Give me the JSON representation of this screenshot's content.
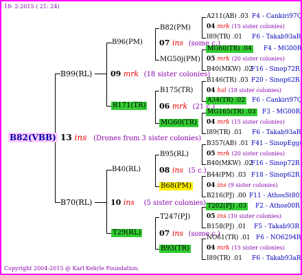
{
  "header": {
    "date": "18- 2-2015 ( 21: 24)"
  },
  "footer": {
    "copyright": "Copyright 2004-2015 @ Karl Kehrle Foundation."
  },
  "queen": {
    "name": "B82(VBB)",
    "year": "13",
    "mark": "ins",
    "note": "(Drones from 3 sister colonies)"
  },
  "sire": {
    "name": "B99(RL)",
    "year": "09",
    "mark": "mrk",
    "note": "(18 sister colonies)"
  },
  "dam": {
    "name": "B70(RL)",
    "year": "10",
    "mark": "ins",
    "note": "(5 sister colonies)"
  },
  "sire_sire": {
    "name": "B96(PM)",
    "year": "07",
    "mark": "ins",
    "note": "(some c.)"
  },
  "sire_dam": {
    "name": "B171(TR)",
    "year": "06",
    "mark": "mrk",
    "note": "(21 c.)"
  },
  "dam_sire": {
    "name": "B40(RL)",
    "year": "08",
    "mark": "ins",
    "note": "(5 c.)"
  },
  "dam_dam": {
    "name": "T29(RL)",
    "year": "07",
    "mark": "ins",
    "note": "(some c.)"
  },
  "gen3": [
    {
      "name": "B82(PM)"
    },
    {
      "name": "MG50j(PM)"
    },
    {
      "name": "B175(TR)"
    },
    {
      "name": "MG60(TR)"
    },
    {
      "name": "B95(RL)"
    },
    {
      "name": "B68(PM)"
    },
    {
      "name": "T247(PJ)"
    },
    {
      "name": "B93(TR)"
    }
  ],
  "gen4": [
    {
      "left": "A211(AB) .03",
      "right": "F4 - Cankiri97Q"
    },
    {
      "year": "04",
      "mark": "mrk",
      "note": "(15 sister colonies)"
    },
    {
      "left": "I89(TR) .01",
      "right": "F6 - Takab93aR"
    },
    {
      "left": "MG60(TR) .04",
      "right": "F4 - MG00R"
    },
    {
      "year": "05",
      "mark": "mrk",
      "note": "(20 sister colonies)"
    },
    {
      "left": "B40(MKW) .02",
      "right": "F16 - Sinop72R"
    },
    {
      "left": "B146(TR) .03",
      "right": "F20 - Sinop62R"
    },
    {
      "year": "04",
      "mark": "hsl",
      "note": "(18 sister colonies)"
    },
    {
      "left": "A34(TR) .02",
      "right": "F6 - Cankiri97Q"
    },
    {
      "left": "MG165(TR) .03",
      "right": "F3 - MG00R"
    },
    {
      "year": "04",
      "mark": "mrk",
      "note": "(15 sister colonies)"
    },
    {
      "left": "I89(TR) .01",
      "right": "F6 - Takab93aR"
    },
    {
      "left": "B357(AB) .01",
      "right": "F41 - SinopEgg86R"
    },
    {
      "year": "05",
      "mark": "mrk",
      "note": "(20 sister colonies)"
    },
    {
      "left": "B40(MKW) .02",
      "right": "F16 - Sinop72R"
    },
    {
      "left": "B44(PM) .03",
      "right": "F18 - Sinop62R"
    },
    {
      "year": "04",
      "mark": "ins",
      "note": "(9 sister colonies)"
    },
    {
      "left": "B216(PJ) .00",
      "right": "F11 - AthosSt80R"
    },
    {
      "left": "T202(PJ) .03",
      "right": "F2 - Athos00R"
    },
    {
      "year": "05",
      "mark": "ins",
      "note": "(10 sister colonies)"
    },
    {
      "left": "B158(PJ) .01",
      "right": "F5 - Takab93R"
    },
    {
      "left": "NO61(TR) .01",
      "right": "F6 - NO6294R"
    },
    {
      "year": "04",
      "mark": "mrk",
      "note": "(15 sister colonies)"
    },
    {
      "left": "I89(TR) .01",
      "right": "F6 - Takab93aR"
    }
  ]
}
